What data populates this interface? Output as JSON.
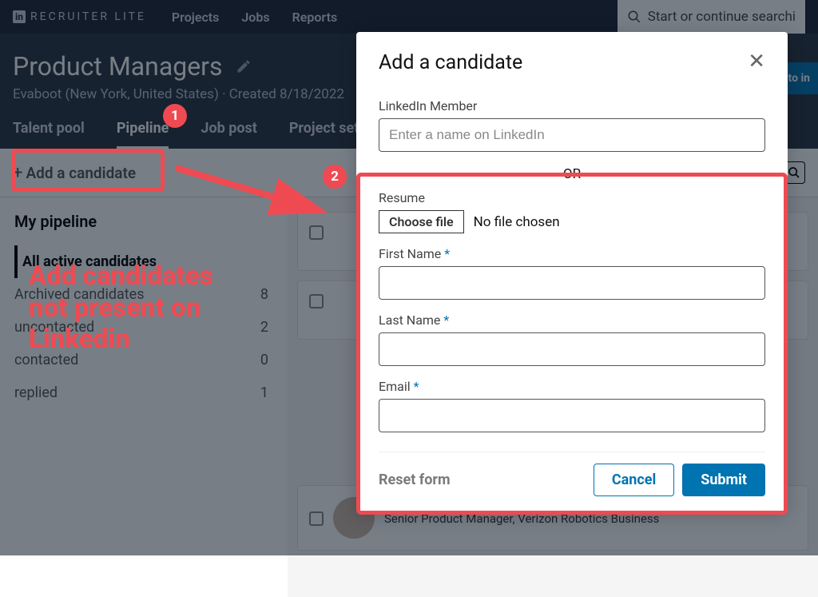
{
  "topnav": {
    "logo_text": "RECRUITER LITE",
    "links": [
      "Projects",
      "Jobs",
      "Reports"
    ],
    "search_placeholder": "Start or continue searchi"
  },
  "project": {
    "title": "Product Managers",
    "meta": "Evaboot (New York, United States) · Created 8/18/2022",
    "connect_pill": "e to in"
  },
  "tabs": [
    {
      "label": "Talent pool",
      "active": false
    },
    {
      "label": "Pipeline",
      "active": true
    },
    {
      "label": "Job post",
      "active": false
    },
    {
      "label": "Project settings",
      "active": false
    }
  ],
  "toolbar": {
    "add_candidate": "Add a candidate"
  },
  "pipeline": {
    "title": "My pipeline",
    "rows": [
      {
        "label": "All active candidates",
        "count": "",
        "active": true
      },
      {
        "label": "Archived candidates",
        "count": "8",
        "active": false
      },
      {
        "label": "uncontacted",
        "count": "2",
        "active": false
      },
      {
        "label": "contacted",
        "count": "0",
        "active": false
      },
      {
        "label": "replied",
        "count": "1",
        "active": false
      }
    ]
  },
  "candidate_peek": {
    "title_line": "Senior Product Manager, Verizon Robotics Business"
  },
  "modal": {
    "title": "Add a candidate",
    "linkedin_label": "LinkedIn Member",
    "linkedin_placeholder": "Enter a name on LinkedIn",
    "or": "OR",
    "resume_label": "Resume",
    "choose_file": "Choose file",
    "no_file": "No file chosen",
    "first_name_label": "First Name",
    "last_name_label": "Last Name",
    "email_label": "Email",
    "reset": "Reset form",
    "cancel": "Cancel",
    "submit": "Submit"
  },
  "annotations": {
    "badge1": "1",
    "badge2": "2",
    "callout": "Add candidates\nnot present on\nLinkedin"
  }
}
